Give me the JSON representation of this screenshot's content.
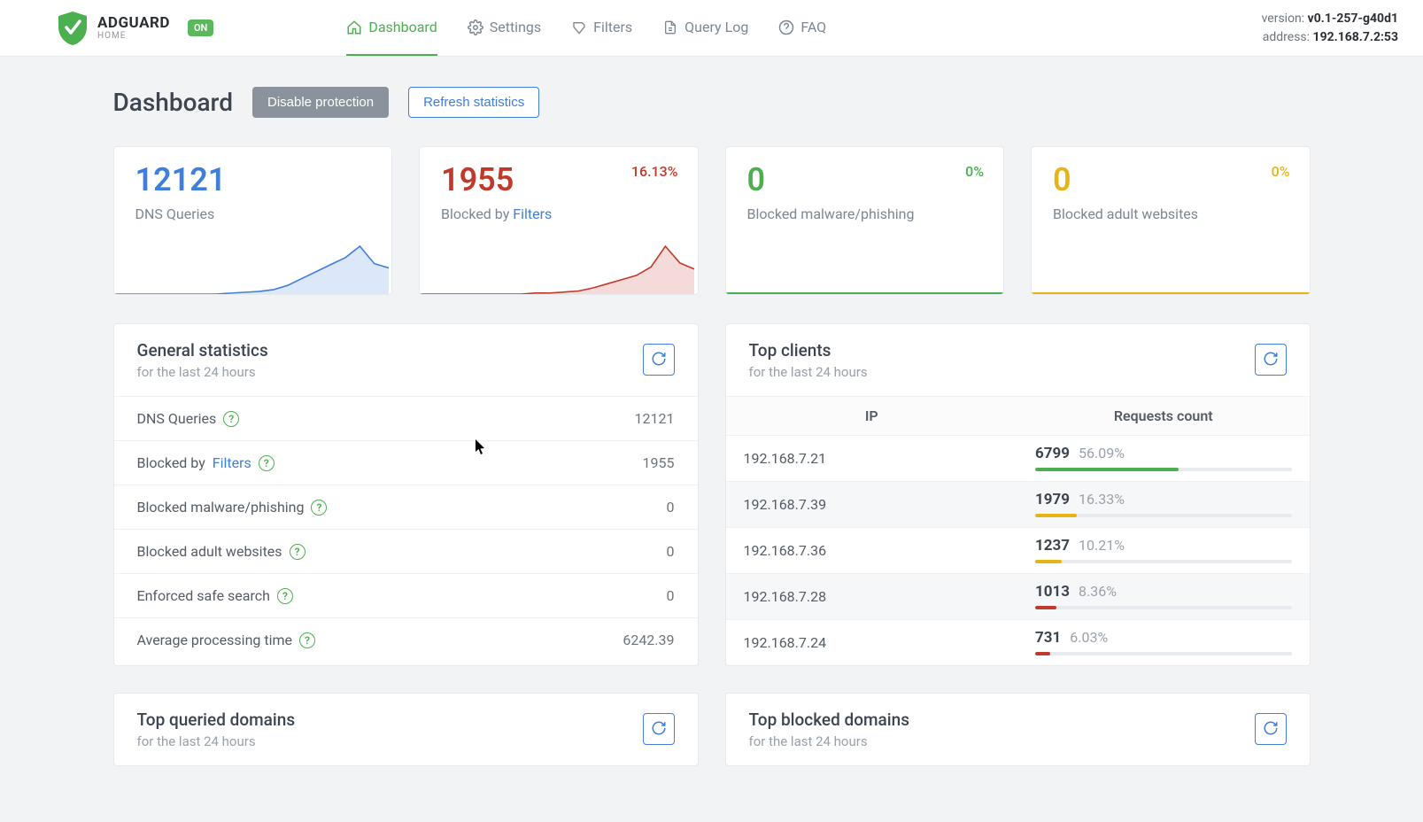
{
  "brand": {
    "name": "ADGUARD",
    "sub": "HOME",
    "on_badge": "ON"
  },
  "topbar": {
    "version_label": "version:",
    "version_value": "v0.1-257-g40d1",
    "address_label": "address:",
    "address_value": "192.168.7.2:53"
  },
  "nav": [
    {
      "label": "Dashboard",
      "active": true
    },
    {
      "label": "Settings",
      "active": false
    },
    {
      "label": "Filters",
      "active": false
    },
    {
      "label": "Query Log",
      "active": false
    },
    {
      "label": "FAQ",
      "active": false
    }
  ],
  "page": {
    "title": "Dashboard",
    "btn_disable": "Disable protection",
    "btn_refresh": "Refresh statistics"
  },
  "cards": {
    "dns": {
      "value": "12121",
      "label": "DNS Queries"
    },
    "filters": {
      "value": "1955",
      "label_pre": "Blocked by ",
      "label_link": "Filters",
      "pct": "16.13%"
    },
    "malware": {
      "value": "0",
      "label": "Blocked malware/phishing",
      "pct": "0%"
    },
    "adult": {
      "value": "0",
      "label": "Blocked adult websites",
      "pct": "0%"
    }
  },
  "general": {
    "title": "General statistics",
    "subtitle": "for the last 24 hours",
    "rows": [
      {
        "label": "DNS Queries",
        "value": "12121"
      },
      {
        "label_pre": "Blocked by ",
        "label_link": "Filters",
        "value": "1955"
      },
      {
        "label": "Blocked malware/phishing",
        "value": "0"
      },
      {
        "label": "Blocked adult websites",
        "value": "0"
      },
      {
        "label": "Enforced safe search",
        "value": "0"
      },
      {
        "label": "Average processing time",
        "value": "6242.39"
      }
    ]
  },
  "top_clients": {
    "title": "Top clients",
    "subtitle": "for the last 24 hours",
    "head_ip": "IP",
    "head_req": "Requests count",
    "rows": [
      {
        "ip": "192.168.7.21",
        "count": "6799",
        "pct": "56.09%",
        "bar_pct": 56.09,
        "color": "#4caf50"
      },
      {
        "ip": "192.168.7.39",
        "count": "1979",
        "pct": "16.33%",
        "bar_pct": 16.33,
        "color": "#e7b416"
      },
      {
        "ip": "192.168.7.36",
        "count": "1237",
        "pct": "10.21%",
        "bar_pct": 10.21,
        "color": "#e7b416"
      },
      {
        "ip": "192.168.7.28",
        "count": "1013",
        "pct": "8.36%",
        "bar_pct": 8.36,
        "color": "#c0392b"
      },
      {
        "ip": "192.168.7.24",
        "count": "731",
        "pct": "6.03%",
        "bar_pct": 6.03,
        "color": "#c0392b"
      }
    ]
  },
  "top_queried": {
    "title": "Top queried domains",
    "subtitle": "for the last 24 hours"
  },
  "top_blocked": {
    "title": "Top blocked domains",
    "subtitle": "for the last 24 hours"
  },
  "chart_data": [
    {
      "type": "area",
      "name": "DNS Queries sparkline",
      "color": "#3f7edb",
      "x": [
        0,
        1,
        2,
        3,
        4,
        5,
        6,
        7,
        8,
        9,
        10,
        11,
        12,
        13,
        14,
        15,
        16,
        17,
        18,
        19
      ],
      "values": [
        0,
        0,
        0,
        0,
        0,
        0,
        0,
        0,
        1,
        2,
        3,
        5,
        10,
        18,
        26,
        34,
        42,
        55,
        35,
        30
      ]
    },
    {
      "type": "area",
      "name": "Blocked by Filters sparkline",
      "color": "#c0392b",
      "x": [
        0,
        1,
        2,
        3,
        4,
        5,
        6,
        7,
        8,
        9,
        10,
        11,
        12,
        13,
        14,
        15,
        16,
        17,
        18,
        19
      ],
      "values": [
        0,
        0,
        0,
        0,
        0,
        0,
        0,
        0,
        1,
        1,
        2,
        3,
        6,
        10,
        14,
        18,
        26,
        46,
        30,
        24
      ]
    }
  ]
}
